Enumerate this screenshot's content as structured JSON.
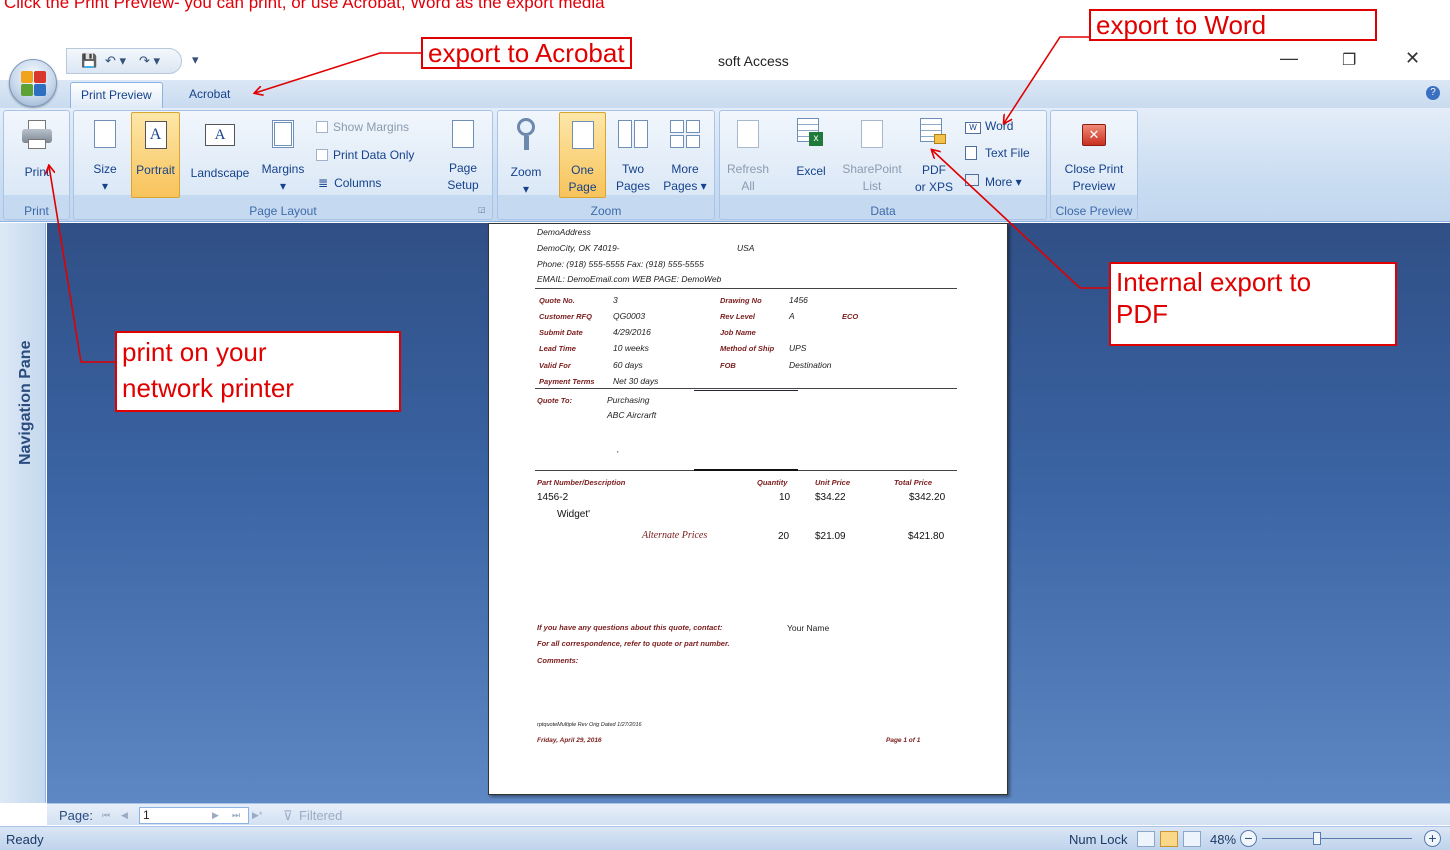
{
  "caption": "Click the Print Preview- you can print, or use Acrobat, Word as the export media",
  "window": {
    "title": "soft Access",
    "minimize": "—",
    "restore": "❐",
    "close": "✕"
  },
  "qat": {
    "save": "💾",
    "undo": "↶ ▾",
    "redo": "↷ ▾",
    "customize": "▾"
  },
  "tabs": [
    "Print Preview",
    "Acrobat"
  ],
  "help": "?",
  "ribbon": {
    "print_group": {
      "print": "Print",
      "title": "Print"
    },
    "page_layout": {
      "size": "Size",
      "portrait": "Portrait",
      "landscape": "Landscape",
      "margins": "Margins",
      "show_margins": "Show Margins",
      "print_data_only": "Print Data Only",
      "columns": "Columns",
      "page_setup_1": "Page",
      "page_setup_2": "Setup",
      "title": "Page Layout"
    },
    "zoom": {
      "zoom": "Zoom",
      "one_page_1": "One",
      "one_page_2": "Page",
      "two_pages_1": "Two",
      "two_pages_2": "Pages",
      "more_pages_1": "More",
      "more_pages_2": "Pages ▾",
      "title": "Zoom"
    },
    "data": {
      "refresh_1": "Refresh",
      "refresh_2": "All",
      "excel": "Excel",
      "sharepoint_1": "SharePoint",
      "sharepoint_2": "List",
      "pdf_1": "PDF",
      "pdf_2": "or XPS",
      "word": "Word",
      "text_file": "Text File",
      "more": "More ▾",
      "title": "Data"
    },
    "close_preview": {
      "close_1": "Close Print",
      "close_2": "Preview",
      "title": "Close Preview"
    }
  },
  "nav_pane": "Navigation Pane",
  "document": {
    "address": "DemoAddress",
    "city": "DemoCity, OK  74019-",
    "country": "USA",
    "phone": "Phone: (918) 555-5555  Fax: (918) 555-5555",
    "email": "EMAIL: DemoEmail.com  WEB PAGE: DemoWeb",
    "fields_left": [
      {
        "label": "Quote No.",
        "value": "3"
      },
      {
        "label": "Customer RFQ",
        "value": "QG0003"
      },
      {
        "label": "Submit Date",
        "value": "4/29/2016"
      },
      {
        "label": "Lead Time",
        "value": "10 weeks"
      },
      {
        "label": "Valid For",
        "value": "60 days"
      },
      {
        "label": "Payment Terms",
        "value": "Net 30 days"
      }
    ],
    "fields_right": [
      {
        "label": "Drawing No",
        "value": "1456"
      },
      {
        "label": "Rev Level",
        "value": "A"
      },
      {
        "label": "Job Name",
        "value": ""
      },
      {
        "label": "Method of Ship",
        "value": "UPS"
      },
      {
        "label": "FOB",
        "value": "Destination"
      }
    ],
    "eco": "ECO",
    "quote_to_label": "Quote To:",
    "quote_to_1": "Purchasing",
    "quote_to_2": "ABC Aircrarft",
    "comma": ",",
    "col_part": "Part Number/Description",
    "col_qty": "Quantity",
    "col_unit": "Unit Price",
    "col_total": "Total Price",
    "part_no": "1456-2",
    "qty_1": "10",
    "unit_1": "$34.22",
    "total_1": "$342.20",
    "desc": "Widget'",
    "alt_label": "Alternate Prices",
    "qty_2": "20",
    "unit_2": "$21.09",
    "total_2": "$421.80",
    "questions": "If you have any questions about this quote, contact:",
    "contact": "Your Name",
    "correspondence": "For all correspondence, refer to quote or part number.",
    "comments": "Comments:",
    "footer_code": "rptquoteMultiple  Rev Orig   Dated  1/27/2016",
    "footer_date": "Friday, April 29, 2016",
    "footer_page": "Page 1 of 1"
  },
  "callouts": {
    "acrobat": "export to Acrobat",
    "word": "export to Word",
    "pdf_1": "Internal export to",
    "pdf_2": "PDF",
    "print_1": "print on your",
    "print_2": "network printer"
  },
  "pagebar": {
    "label": "Page:",
    "first": "⏮",
    "prev": "◀",
    "value": "1",
    "next": "▶",
    "last": "⏭",
    "new": "▶*",
    "filter": "Filtered"
  },
  "status": {
    "ready": "Ready",
    "num_lock": "Num Lock",
    "zoom": "48%",
    "minus": "−",
    "plus": "+"
  }
}
